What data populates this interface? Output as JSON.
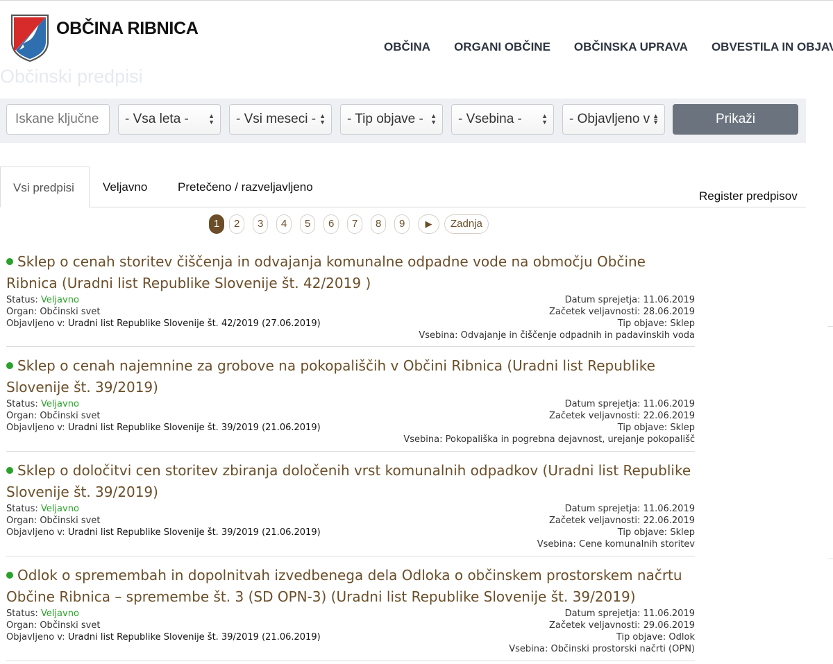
{
  "site": {
    "name": "OBČINA RIBNICA"
  },
  "nav": [
    {
      "label": "OBČINA"
    },
    {
      "label": "ORGANI OBČINE"
    },
    {
      "label": "OBČINSKA UPRAVA"
    },
    {
      "label": "OBVESTILA IN OBJAVE"
    }
  ],
  "page_title": "Občinski predpisi",
  "filters": {
    "keyword_placeholder": "Iskane ključne",
    "year": "- Vsa leta -",
    "month": "- Vsi meseci -",
    "type": "- Tip objave -",
    "content": "- Vsebina -",
    "published": "- Objavljeno v -",
    "show_button": "Prikaži"
  },
  "tabs": [
    {
      "label": "Vsi predpisi",
      "active": true
    },
    {
      "label": "Veljavno"
    },
    {
      "label": "Pretečeno / razveljavljeno"
    }
  ],
  "register_link": "Register predpisov",
  "pagination": {
    "pages": [
      "1",
      "2",
      "3",
      "4",
      "5",
      "6",
      "7",
      "8",
      "9"
    ],
    "current": "1",
    "next": "▶",
    "last": "Zadnja"
  },
  "labels": {
    "status": "Status:",
    "organ": "Organ:",
    "published_in": "Objavljeno v:",
    "adopted": "Datum sprejetja:",
    "validity_start": "Začetek veljavnosti:",
    "type": "Tip objave:",
    "content": "Vsebina:"
  },
  "entries": [
    {
      "title": "Sklep o cenah storitev čiščenja in odvajanja komunalne odpadne vode na območju Občine Ribnica (Uradni list Republike Slovenije št. 42/2019 )",
      "status": "Veljavno",
      "organ": "Občinski svet",
      "published": "Uradni list Republike Slovenije št. 42/2019 (27.06.2019)",
      "adopted": "11.06.2019",
      "validity_start": "28.06.2019",
      "type": "Sklep",
      "content": "Odvajanje in čiščenje odpadnih in padavinskih voda"
    },
    {
      "title": "Sklep o cenah najemnine za grobove na pokopališčih v Občini Ribnica (Uradni list Republike Slovenije št. 39/2019)",
      "status": "Veljavno",
      "organ": "Občinski svet",
      "published": "Uradni list Republike Slovenije št. 39/2019 (21.06.2019)",
      "adopted": "11.06.2019",
      "validity_start": "22.06.2019",
      "type": "Sklep",
      "content": "Pokopališka in pogrebna dejavnost, urejanje pokopališč"
    },
    {
      "title": "Sklep o določitvi cen storitev zbiranja določenih vrst komunalnih odpadkov (Uradni list Republike Slovenije št. 39/2019)",
      "status": "Veljavno",
      "organ": "Občinski svet",
      "published": "Uradni list Republike Slovenije št. 39/2019 (21.06.2019)",
      "adopted": "11.06.2019",
      "validity_start": "22.06.2019",
      "type": "Sklep",
      "content": "Cene komunalnih storitev"
    },
    {
      "title": "Odlok o spremembah in dopolnitvah izvedbenega dela Odloka o občinskem prostorskem načrtu Občine Ribnica – spremembe št. 3 (SD OPN-3) (Uradni list Republike Slovenije št. 39/2019)",
      "status": "Veljavno",
      "organ": "Občinski svet",
      "published": "Uradni list Republike Slovenije št. 39/2019 (21.06.2019)",
      "adopted": "11.06.2019",
      "validity_start": "29.06.2019",
      "type": "Odlok",
      "content": "Občinski prostorski načrti (OPN)"
    }
  ]
}
